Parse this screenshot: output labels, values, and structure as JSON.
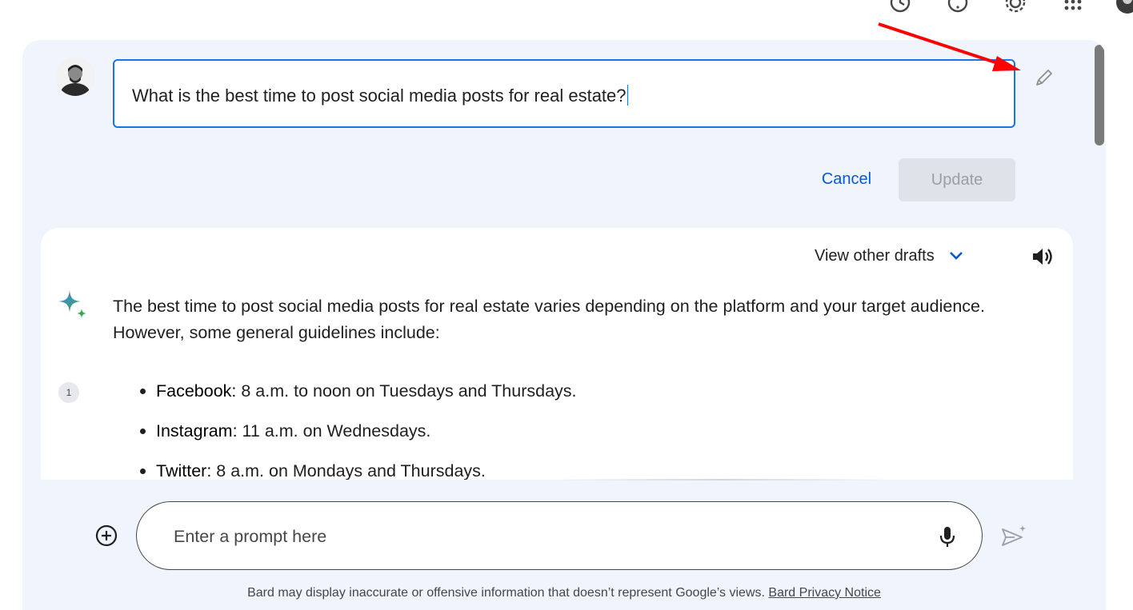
{
  "topbar": {
    "icons": [
      "history-icon",
      "help-icon",
      "settings-icon",
      "apps-icon",
      "account-avatar"
    ]
  },
  "conversation": {
    "user_prompt": "What is the best time to post social media posts for real estate?",
    "cancel_label": "Cancel",
    "update_label": "Update"
  },
  "response": {
    "drafts_label": "View other drafts",
    "intro": "The best time to post social media posts for real estate varies depending on the platform and your target audience. However, some general guidelines include:",
    "citation": "1",
    "items": [
      {
        "label": "Facebook:",
        "text": " 8 a.m. to noon on Tuesdays and Thursdays."
      },
      {
        "label": "Instagram:",
        "text": " 11 a.m. on Wednesdays."
      },
      {
        "label": "Twitter:",
        "text": " 8 a.m. on Mondays and Thursdays."
      }
    ]
  },
  "composer": {
    "placeholder": "Enter a prompt here"
  },
  "footer": {
    "disclaimer": "Bard may display inaccurate or offensive information that doesn’t represent Google’s views.",
    "privacy_link": "Bard Privacy Notice"
  },
  "colors": {
    "accent": "#1a73e8",
    "link": "#0b57d0",
    "panel": "#f0f4fc",
    "annotation": "#ff0000"
  }
}
